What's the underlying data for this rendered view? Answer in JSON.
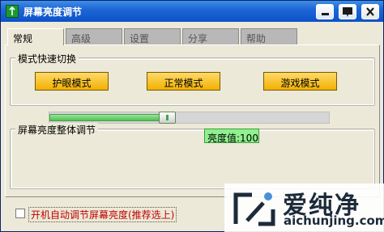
{
  "window": {
    "title": "屏幕亮度调节"
  },
  "tabs": [
    {
      "label": "常规",
      "active": true
    },
    {
      "label": "高级",
      "active": false
    },
    {
      "label": "设置",
      "active": false
    },
    {
      "label": "分享",
      "active": false
    },
    {
      "label": "帮助",
      "active": false
    }
  ],
  "mode_group": {
    "label": "模式快速切换",
    "buttons": [
      "护眼模式",
      "正常模式",
      "游戏模式"
    ]
  },
  "brightness_group": {
    "label": "屏幕亮度整体调节",
    "value_text": "亮度值:100",
    "level": 0.42
  },
  "autostart": {
    "label": "开机自动调节屏幕亮度(推荐选上)",
    "checked": false
  },
  "watermark": {
    "cn": "爱纯净",
    "en": "aichunjing.com"
  },
  "colors": {
    "title_bar": "#0b52c9",
    "button_gold": "#f2b100",
    "slider_green": "#4fc24f",
    "checkbox_label": "#c00000"
  }
}
